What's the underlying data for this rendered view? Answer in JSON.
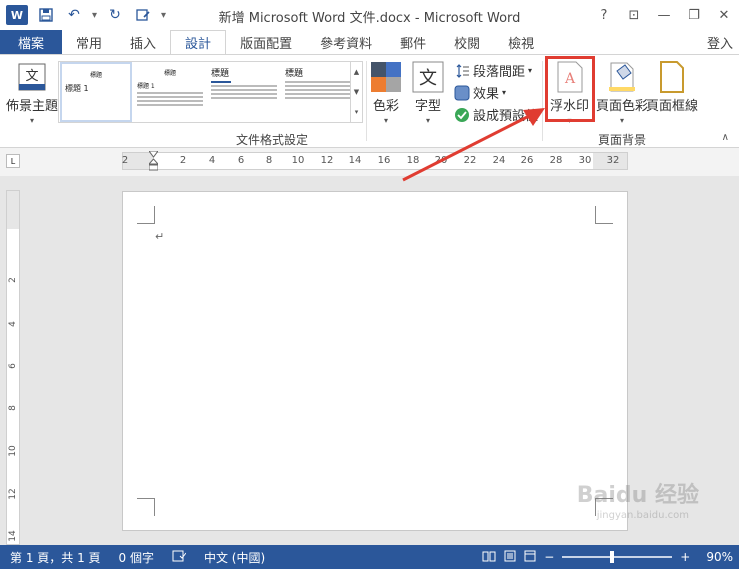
{
  "app": {
    "title": "新增 Microsoft Word 文件.docx - Microsoft Word",
    "logo_letter": "W"
  },
  "window_controls": {
    "help": "?",
    "ribbon_opts": "⊡",
    "minimize": "—",
    "restore": "❐",
    "close": "✕"
  },
  "tabs": [
    {
      "label": "檔案"
    },
    {
      "label": "常用"
    },
    {
      "label": "插入"
    },
    {
      "label": "設計"
    },
    {
      "label": "版面配置"
    },
    {
      "label": "參考資料"
    },
    {
      "label": "郵件"
    },
    {
      "label": "校閱"
    },
    {
      "label": "檢視"
    }
  ],
  "active_tab": "設計",
  "signin_label": "登入",
  "ribbon": {
    "theme_label": "佈景主題",
    "theme_icon_text": "文",
    "gallery": {
      "thumb1_heading": "標題",
      "thumb1_title": "標題 1",
      "thumb2_heading": "標題",
      "thumb2_title": "標題 1",
      "thumb3_heading": "標題",
      "thumb4_heading": "標題"
    },
    "colors_label": "色彩",
    "fonts_label": "字型",
    "fonts_icon_text": "文",
    "para_spacing_label": "段落間距",
    "effects_label": "效果",
    "set_default_label": "設成預設值",
    "doc_format_group": "文件格式設定",
    "watermark_label": "浮水印",
    "page_color_label": "頁面色彩",
    "page_border_label": "頁面框線",
    "page_bg_group": "頁面背景"
  },
  "ruler": {
    "h_ticks": [
      "2",
      "2",
      "4",
      "6",
      "8",
      "10",
      "12",
      "14",
      "16",
      "18",
      "20",
      "22",
      "24",
      "26",
      "28",
      "30",
      "32"
    ],
    "v_ticks": [
      "2",
      "4",
      "6",
      "8",
      "10",
      "12",
      "14"
    ],
    "corner": "L"
  },
  "document": {
    "para_mark": "↵"
  },
  "status": {
    "page": "第 1 頁，共 1 頁",
    "words": "0 個字",
    "lang": "中文 (中國)",
    "zoom": "90%",
    "zoom_minus": "−",
    "zoom_plus": "+"
  },
  "watermark_overlay": {
    "main": "Baidu 经验",
    "sub": "jingyan.baidu.com"
  },
  "colors": {
    "brand": "#2b579a",
    "highlight": "#e03c31"
  }
}
